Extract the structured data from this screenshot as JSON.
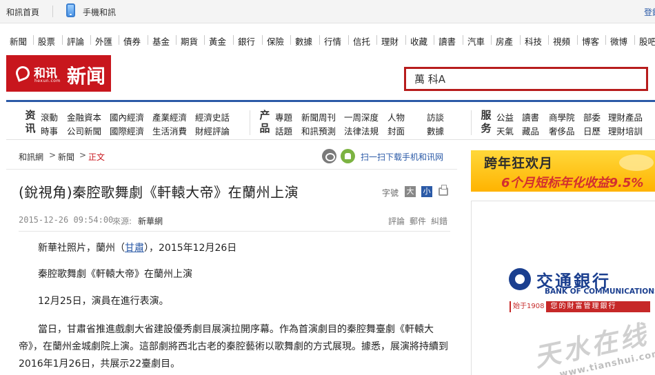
{
  "topbar": {
    "home": "和訊首頁",
    "mobile": "手機和訊",
    "login": "登錄"
  },
  "channels": [
    "新聞",
    "股票",
    "評論",
    "外匯",
    "債券",
    "基金",
    "期貨",
    "黃金",
    "銀行",
    "保險",
    "數據",
    "行情",
    "信托",
    "理財",
    "收藏",
    "讀書",
    "汽車",
    "房產",
    "科技",
    "視頻",
    "博客",
    "微博",
    "股吧"
  ],
  "logo": {
    "brand": "和讯",
    "domain": "hexun.com",
    "news": "新闻"
  },
  "search": {
    "value": "萬 科A"
  },
  "categories": {
    "news": {
      "title": "资讯",
      "row1": [
        "滾動",
        "金融資本",
        "國內經濟",
        "產業經濟",
        "經濟史話"
      ],
      "row2": [
        "時事",
        "公司新聞",
        "國際經濟",
        "生活消費",
        "財經評論"
      ]
    },
    "product": {
      "title": "产品",
      "row1": [
        "專題",
        "新聞周刊",
        "一周深度",
        "人物",
        "訪談"
      ],
      "row2": [
        "話題",
        "和訊預測",
        "法律法規",
        "封面",
        "數據"
      ]
    },
    "service": {
      "title": "服务",
      "row1": [
        "公益",
        "讀書",
        "商學院",
        "部委",
        "理財產品"
      ],
      "row2": [
        "天氣",
        "藏品",
        "奢侈品",
        "日歷",
        "理財培訓"
      ]
    }
  },
  "breadcrumb": {
    "home": "和訊網",
    "section": "新聞",
    "current": "正文",
    "scan": "扫一扫下载手机和讯网"
  },
  "article": {
    "title": "(銳視角)秦腔歌舞劇《軒轅大帝》在蘭州上演",
    "font_label": "字號",
    "font_large": "大",
    "font_small": "小",
    "date": "2015-12-26 09:54:00",
    "source_label": "來源:",
    "source": "新華網",
    "actions": [
      "評論",
      "郵件",
      "糾錯"
    ],
    "p1_prefix": "新華社照片，蘭州（",
    "p1_link": "甘肅",
    "p1_suffix": "），2015年12月26日",
    "p2": "秦腔歌舞劇《軒轅大帝》在蘭州上演",
    "p3": "12月25日，演員在進行表演。",
    "p4": "當日，甘肅省推進戲劇大省建設優秀劇目展演拉開序幕。作為首演劇目的秦腔舞臺劇《軒轅大帝》，在蘭州金城劇院上演。這部劇將西北古老的秦腔藝術以歌舞劇的方式展現。據悉，展演將持續到2016年1月26日，共展示22臺劇目。"
  },
  "ads": {
    "promo_line1": "跨年狂欢月",
    "promo_line2": "6个月短标年化收益9.5%",
    "bank_name": "交通銀行",
    "bank_en": "BANK OF COMMUNICATIONS",
    "bank_year": "始于1908",
    "bank_slogan": "您的財富管理銀行"
  },
  "watermark": {
    "text": "天水在线",
    "url": "www.tianshui.com.cn"
  },
  "colors": {
    "brand_red": "#c8161d",
    "link_blue": "#2b5aa7",
    "bank_blue": "#1b3f8f"
  }
}
